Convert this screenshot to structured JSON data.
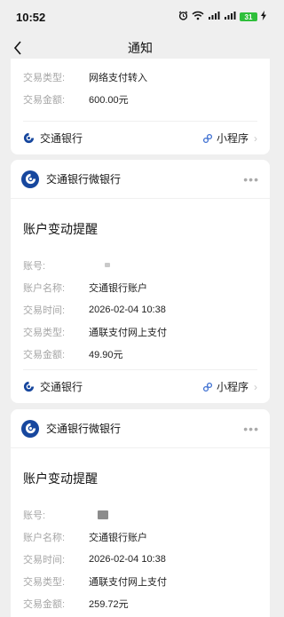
{
  "status_bar": {
    "time": "10:52",
    "battery": "31"
  },
  "nav": {
    "title": "通知"
  },
  "labels": {
    "account_no": "账号:",
    "account_name": "账户名称:",
    "trade_time": "交易时间:",
    "trade_type": "交易类型:",
    "trade_amount": "交易金额:"
  },
  "card0": {
    "trade_type": "网络支付转入",
    "amount": "600.00元",
    "footer_bank": "交通银行",
    "footer_mini": "小程序"
  },
  "card1": {
    "brand": "交通银行微银行",
    "title": "账户变动提醒",
    "account_no": "",
    "account_name": "交通银行账户",
    "trade_time": "2026-02-04 10:38",
    "trade_type": "通联支付网上支付",
    "amount": "49.90元",
    "footer_bank": "交通银行",
    "footer_mini": "小程序"
  },
  "card2": {
    "brand": "交通银行微银行",
    "title": "账户变动提醒",
    "account_no": "",
    "account_name": "交通银行账户",
    "trade_time": "2026-02-04 10:38",
    "trade_type": "通联支付网上支付",
    "amount": "259.72元"
  },
  "colors": {
    "brand_blue": "#17479e",
    "label_gray": "#a6a6a6",
    "background": "#efefef"
  }
}
